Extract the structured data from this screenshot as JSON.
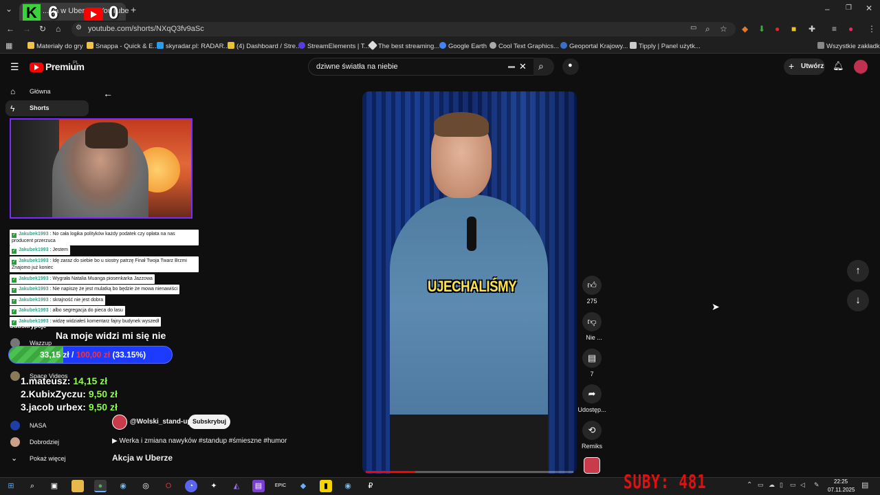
{
  "browser": {
    "tab_title": "...cja w Uberze - YouTube",
    "url": "youtube.com/shorts/NXqQ3fv9aSc",
    "bookmarks": [
      {
        "label": "Materiały do gry",
        "color": "#f0c14b"
      },
      {
        "label": "Snappa - Quick & E...",
        "color": "#f0c14b"
      },
      {
        "label": "skyradar.pl: RADAR...",
        "color": "#2b9de8"
      },
      {
        "label": "(4) Dashboard / Stre...",
        "color": "#e8c233"
      },
      {
        "label": "StreamElements | T...",
        "color": "#5a3de0"
      },
      {
        "label": "The best streaming...",
        "color": "#dddddd"
      },
      {
        "label": "Google Earth",
        "color": "#4285f4"
      },
      {
        "label": "Cool Text Graphics...",
        "color": "#aaaaaa"
      },
      {
        "label": "Geoportal Krajowy...",
        "color": "#3a70c8"
      },
      {
        "label": "Tipply | Panel użytk...",
        "color": "#cccccc"
      }
    ],
    "all_bookmarks": "Wszystkie zakładki"
  },
  "stream_counters": {
    "kick_letter": "K",
    "kick_count": "6",
    "youtube_count": "0"
  },
  "youtube": {
    "brand": "Premium",
    "brand_sup": "PL",
    "search_query": "dziwne światła na niebie",
    "create_label": "Utwórz"
  },
  "sidebar": {
    "items": [
      {
        "label": "Główna"
      },
      {
        "label": "Shorts"
      }
    ],
    "subscriptions_heading": "Subskrypcje",
    "subscriptions": [
      {
        "label": "Wazzup",
        "color": "#777777"
      },
      {
        "label": "Space Videos",
        "color": "#8a7a5a"
      },
      {
        "label": "NASA",
        "color": "#1f3fa8"
      },
      {
        "label": "Dobrodziej",
        "color": "#c9a08a"
      }
    ],
    "show_more": "Pokaż więcej"
  },
  "chat": [
    {
      "user": "Jakubek1993",
      "text": "No cała logika polityków każdy podatek czy opłata na nas producent przerzuca"
    },
    {
      "user": "Jakubek1993",
      "text": "Jestem"
    },
    {
      "user": "Jakubek1993",
      "text": "Idę zaraz do siebie bo u siostry patrzę Finał Twoja Twarz Brzmi Znajomo już koniec"
    },
    {
      "user": "Jakubek1993",
      "text": "Wygrała Natalia Muanga piosenkarka Jazzowa"
    },
    {
      "user": "Jakubek1993",
      "text": "Nie napiszę że jest mulatką bo będzie że mowa nienawiści"
    },
    {
      "user": "Jakubek1993",
      "text": "skrajność nie jest dobra"
    },
    {
      "user": "Jakubek1993",
      "text": "albo segregacja do pieca do lasu"
    },
    {
      "user": "Jakubek1993",
      "text": "widzę widziałeś komentarz fajny budynek wyszedł"
    }
  ],
  "goal": {
    "title": "Na moje widzi mi się nie",
    "current": "33,15 zł",
    "separator": "/",
    "target": "100,00 zł",
    "percent_text": "(33.15%)",
    "fraction": 0.3315,
    "top": [
      {
        "rank": "1.",
        "name": "mateusz:",
        "amount": "14,15 zł"
      },
      {
        "rank": "2.",
        "name": "KubixZyczu:",
        "amount": "9,50 zł"
      },
      {
        "rank": "3.",
        "name": "jacob urbex:",
        "amount": "9,50 zł"
      }
    ]
  },
  "short": {
    "caption": "UJECHALIŚMY",
    "channel": "@Wolski_stand-up",
    "subscribe_label": "Subskrybuj",
    "description": "Werka i zmiana nawyków  #standup #śmieszne #humor",
    "title": "Akcja w Uberze",
    "progress_fraction": 0.24,
    "actions": {
      "like_count": "275",
      "dislike_label": "Nie ...",
      "comments_count": "7",
      "share_label": "Udostęp...",
      "remix_label": "Remiks"
    }
  },
  "overlay_subs": "SUBY: 481",
  "taskbar": {
    "time": "22:25",
    "date": "07.11.2025"
  }
}
